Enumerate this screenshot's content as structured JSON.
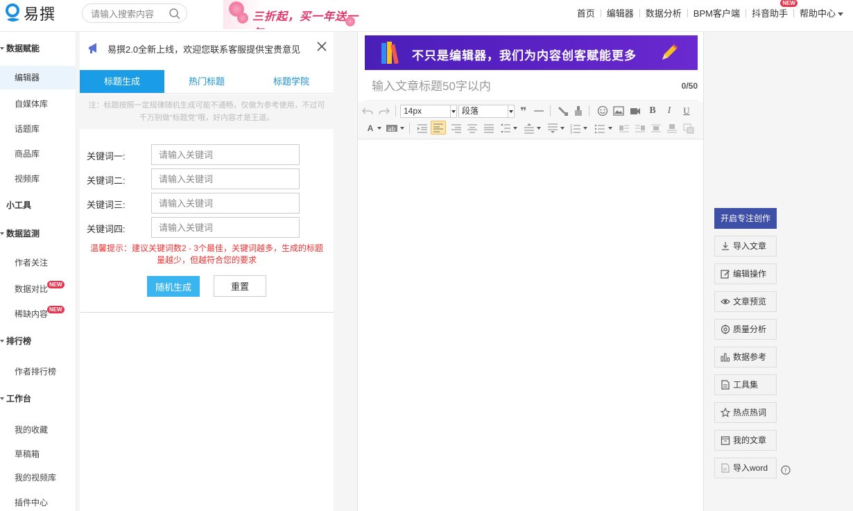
{
  "header": {
    "logo_text": "易撰",
    "search_placeholder": "请输入搜索内容",
    "promo_text": "三折起，买一年送一年",
    "nav": [
      {
        "label": "首页"
      },
      {
        "label": "编辑器"
      },
      {
        "label": "数据分析"
      },
      {
        "label": "BPM客户端"
      },
      {
        "label": "抖音助手",
        "badge": "NEW"
      },
      {
        "label": "帮助中心"
      }
    ]
  },
  "sidebar": {
    "sections": [
      {
        "label": "数据赋能",
        "items": [
          "编辑器",
          "自媒体库",
          "话题库",
          "商品库",
          "视频库"
        ]
      },
      {
        "label": "小工具",
        "items": []
      },
      {
        "label": "数据监测",
        "items": [
          "作者关注",
          "数据对比",
          "稀缺内容"
        ]
      },
      {
        "label": "排行榜",
        "items": [
          "作者排行榜"
        ]
      },
      {
        "label": "工作台",
        "items": [
          "我的收藏",
          "草稿箱",
          "我的视频库",
          "插件中心"
        ]
      }
    ],
    "new_badge": "NEW",
    "active_item": "编辑器"
  },
  "panel": {
    "notice": "易撰2.0全新上线，欢迎您联系客服提供宝贵意见",
    "tabs": [
      "标题生成",
      "热门标题",
      "标题学院"
    ],
    "active_tab": "标题生成",
    "note": "注：标题按照一定规律随机生成可能不通畅，仅做为参考使用，不过可千万别做“标题党”哦，好内容才是王道。",
    "keywords": [
      {
        "label": "关键词一:",
        "placeholder": "请输入关键词"
      },
      {
        "label": "关键词二:",
        "placeholder": "请输入关键词"
      },
      {
        "label": "关键词三:",
        "placeholder": "请输入关键词"
      },
      {
        "label": "关键词四:",
        "placeholder": "请输入关键词"
      }
    ],
    "warning": "温馨提示：建议关键词数2 - 3个最佳，关键词越多，生成的标题量越少，但越符合您的要求",
    "generate_label": "随机生成",
    "reset_label": "重置"
  },
  "editor": {
    "banner_text": "不只是编辑器，我们为内容创客赋能更多",
    "title_placeholder": "输入文章标题50字以内",
    "title_count": "0/50",
    "font_size": "14px",
    "paragraph": "段落"
  },
  "actions": {
    "primary": "开启专注创作",
    "items": [
      {
        "label": "导入文章",
        "icon": "download-icon"
      },
      {
        "label": "编辑操作",
        "icon": "edit-icon"
      },
      {
        "label": "文章预览",
        "icon": "eye-icon"
      },
      {
        "label": "质量分析",
        "icon": "target-icon"
      },
      {
        "label": "数据参考",
        "icon": "bar-chart-icon"
      },
      {
        "label": "工具集",
        "icon": "document-icon"
      },
      {
        "label": "热点热词",
        "icon": "star-icon"
      },
      {
        "label": "我的文章",
        "icon": "archive-icon"
      },
      {
        "label": "导入word",
        "icon": "word-icon"
      }
    ]
  }
}
